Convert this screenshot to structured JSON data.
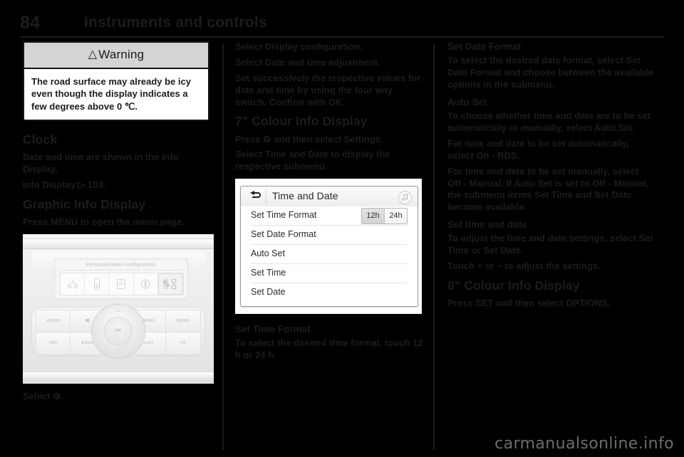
{
  "header": {
    "page_number": "84",
    "title": "Instruments and controls"
  },
  "warning": {
    "title": "Warning",
    "icon": "warning-triangle-icon",
    "text": "The road surface may already be icy even though the display indicates a few degrees above 0 ℃."
  },
  "left_column": {
    "clock_heading": "Clock",
    "clock_para": "Date and time are shown in the Info Display.",
    "clock_ref": "Info Display ▷ 103.",
    "graphic_heading": "Graphic Info Display",
    "graphic_para": "Press MENU to open the menu page.",
    "figure_caption": "Select ⚙."
  },
  "radio_panel": {
    "display_title": "Personalisation-configuration",
    "display_icons": [
      "vehicle-settings-icon",
      "display-settings-icon",
      "radio-settings-icon",
      "bluetooth-icon",
      "audio-settings-icon"
    ],
    "buttons": [
      "AUDIO",
      "☎",
      "MENU",
      "BAND",
      "SRC",
      "BACK",
      "LIST",
      "TA"
    ],
    "ok_label": "OK"
  },
  "middle_column": {
    "para1": "Select Display configuration.",
    "para2": "Select Date and time adjustment.",
    "para3": "Set successively the respective values for date and time by using the four way switch. Confirm with OK.",
    "heading_7inch": "7\" Colour Info Display",
    "para4": "Press ⚙ and then select Settings.",
    "para5": "Select Time and Date to display the respective submenu.",
    "set_time_format_heading": "Set Time Format",
    "set_time_format_para": "To select the desired time format, touch 12 h or 24 h."
  },
  "infotainment": {
    "back_icon": "back-arrow-icon",
    "title": "Time and Date",
    "media_icon": "music-note-icon",
    "rows": [
      {
        "label": "Set Time Format",
        "options": [
          "12h",
          "24h"
        ],
        "selected": "12h"
      },
      {
        "label": "Set Date Format"
      },
      {
        "label": "Auto Set"
      },
      {
        "label": "Set Time"
      },
      {
        "label": "Set Date"
      }
    ]
  },
  "right_column": {
    "set_date_format_heading": "Set Date Format",
    "set_date_format_para": "To select the desired date format, select Set Date Format and choose between the available options in the submenu.",
    "auto_set_heading": "Auto Set",
    "auto_set_para1": "To choose whether time and date are to be set automatically or manually, select Auto Set.",
    "auto_set_para2": "For time and date to be set automatically, select On - RDS.",
    "auto_set_para3": "For time and date to be set manually, select Off - Manual. If Auto Set is set to Off - Manual, the submenu items Set Time and Set Date become available.",
    "set_time_date_heading": "Set time and date",
    "set_time_date_para1": "To adjust the time and date settings, select Set Time or Set Date.",
    "set_time_date_para2": "Touch + or – to adjust the settings.",
    "heading_8inch": "8\" Colour Info Display",
    "para_8inch": "Press SET and then select OPTIONS."
  },
  "watermark": "carmanualsonline.info"
}
